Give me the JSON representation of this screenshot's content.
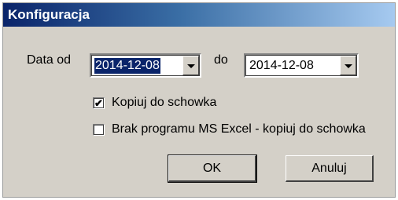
{
  "window": {
    "title": "Konfiguracja"
  },
  "dates": {
    "from_label": "Data od",
    "from_value": "2014-12-08",
    "to_label": "do",
    "to_value": "2014-12-08"
  },
  "options": {
    "copy_clipboard_label": "Kopiuj do schowka",
    "copy_clipboard_checked": true,
    "no_excel_label": "Brak programu MS Excel - kopiuj do schowka",
    "no_excel_checked": false
  },
  "buttons": {
    "ok_label": "OK",
    "cancel_label": "Anuluj"
  },
  "colors": {
    "titlebar_start": "#0a246a",
    "titlebar_end": "#a6caf0",
    "face": "#d4d0c8",
    "selection": "#0a246a"
  }
}
